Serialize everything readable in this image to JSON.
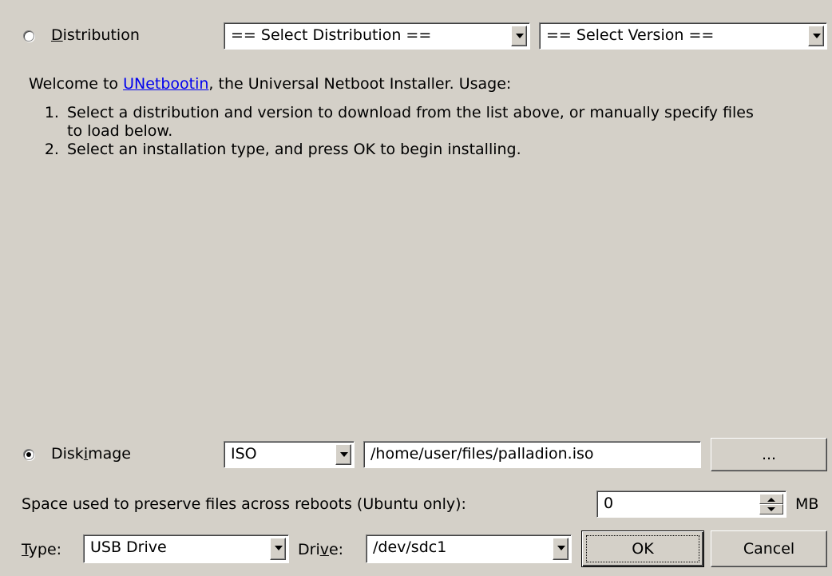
{
  "distribution": {
    "radio_label_prefix": "",
    "radio_label_mnemonic": "D",
    "radio_label_rest": "istribution",
    "select_distribution": "== Select Distribution ==",
    "select_version": "== Select Version =="
  },
  "description": {
    "welcome_prefix": "Welcome to ",
    "link_text": "UNetbootin",
    "welcome_suffix": ", the Universal Netboot Installer. Usage:",
    "steps": [
      "Select a distribution and version to download from the list above, or manually specify files to load below.",
      "Select an installation type, and press OK to begin installing."
    ]
  },
  "diskimage": {
    "label_prefix": "Disk",
    "label_mnemonic": "i",
    "label_rest": "mage",
    "format": "ISO",
    "path": "/home/user/files/palladion.iso",
    "browse_label": "..."
  },
  "persistence": {
    "label": "Space used to preserve files across reboots (Ubuntu only):",
    "value": "0",
    "unit": "MB"
  },
  "bottom": {
    "type_label_mnemonic": "T",
    "type_label_rest": "ype:",
    "type_value": "USB Drive",
    "drive_label_prefix": "Dri",
    "drive_label_mnemonic": "v",
    "drive_label_rest": "e:",
    "drive_value": "/dev/sdc1",
    "ok_label": "OK",
    "cancel_label": "Cancel"
  }
}
